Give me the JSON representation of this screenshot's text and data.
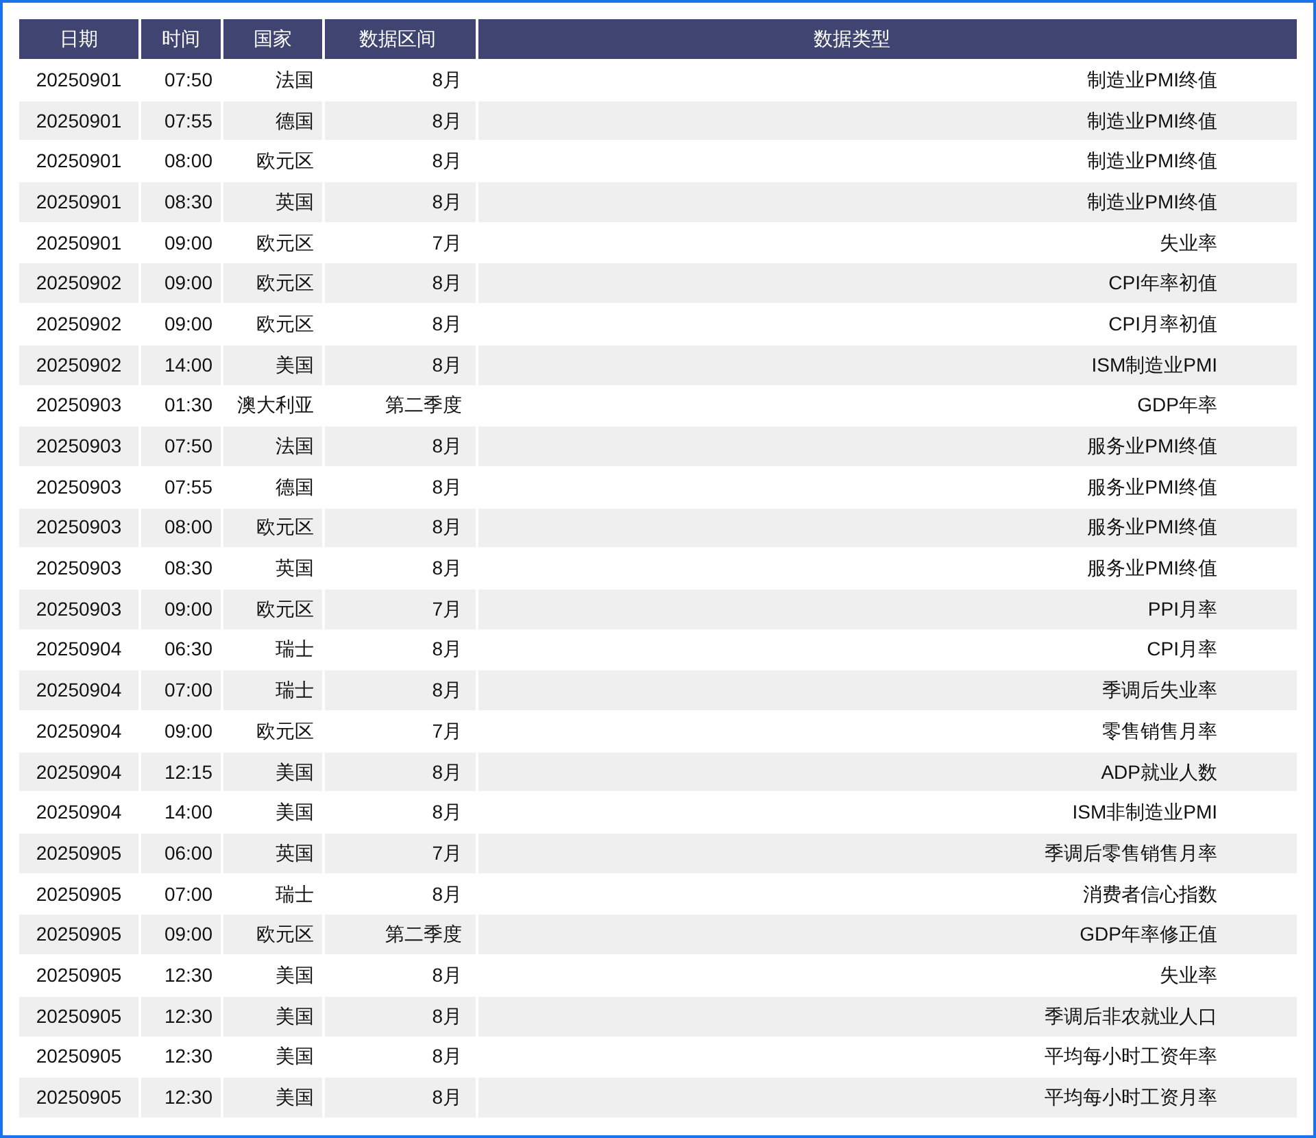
{
  "table": {
    "columns": [
      "日期",
      "时间",
      "国家",
      "数据区间",
      "数据类型"
    ],
    "rows": [
      [
        "20250901",
        "07:50",
        "法国",
        "8月",
        "制造业PMI终值"
      ],
      [
        "20250901",
        "07:55",
        "德国",
        "8月",
        "制造业PMI终值"
      ],
      [
        "20250901",
        "08:00",
        "欧元区",
        "8月",
        "制造业PMI终值"
      ],
      [
        "20250901",
        "08:30",
        "英国",
        "8月",
        "制造业PMI终值"
      ],
      [
        "20250901",
        "09:00",
        "欧元区",
        "7月",
        "失业率"
      ],
      [
        "20250902",
        "09:00",
        "欧元区",
        "8月",
        "CPI年率初值"
      ],
      [
        "20250902",
        "09:00",
        "欧元区",
        "8月",
        "CPI月率初值"
      ],
      [
        "20250902",
        "14:00",
        "美国",
        "8月",
        "ISM制造业PMI"
      ],
      [
        "20250903",
        "01:30",
        "澳大利亚",
        "第二季度",
        "GDP年率"
      ],
      [
        "20250903",
        "07:50",
        "法国",
        "8月",
        "服务业PMI终值"
      ],
      [
        "20250903",
        "07:55",
        "德国",
        "8月",
        "服务业PMI终值"
      ],
      [
        "20250903",
        "08:00",
        "欧元区",
        "8月",
        "服务业PMI终值"
      ],
      [
        "20250903",
        "08:30",
        "英国",
        "8月",
        "服务业PMI终值"
      ],
      [
        "20250903",
        "09:00",
        "欧元区",
        "7月",
        "PPI月率"
      ],
      [
        "20250904",
        "06:30",
        "瑞士",
        "8月",
        "CPI月率"
      ],
      [
        "20250904",
        "07:00",
        "瑞士",
        "8月",
        "季调后失业率"
      ],
      [
        "20250904",
        "09:00",
        "欧元区",
        "7月",
        "零售销售月率"
      ],
      [
        "20250904",
        "12:15",
        "美国",
        "8月",
        "ADP就业人数"
      ],
      [
        "20250904",
        "14:00",
        "美国",
        "8月",
        "ISM非制造业PMI"
      ],
      [
        "20250905",
        "06:00",
        "英国",
        "7月",
        "季调后零售销售月率"
      ],
      [
        "20250905",
        "07:00",
        "瑞士",
        "8月",
        "消费者信心指数"
      ],
      [
        "20250905",
        "09:00",
        "欧元区",
        "第二季度",
        "GDP年率修正值"
      ],
      [
        "20250905",
        "12:30",
        "美国",
        "8月",
        "失业率"
      ],
      [
        "20250905",
        "12:30",
        "美国",
        "8月",
        "季调后非农就业人口"
      ],
      [
        "20250905",
        "12:30",
        "美国",
        "8月",
        "平均每小时工资年率"
      ],
      [
        "20250905",
        "12:30",
        "美国",
        "8月",
        "平均每小时工资月率"
      ]
    ]
  }
}
